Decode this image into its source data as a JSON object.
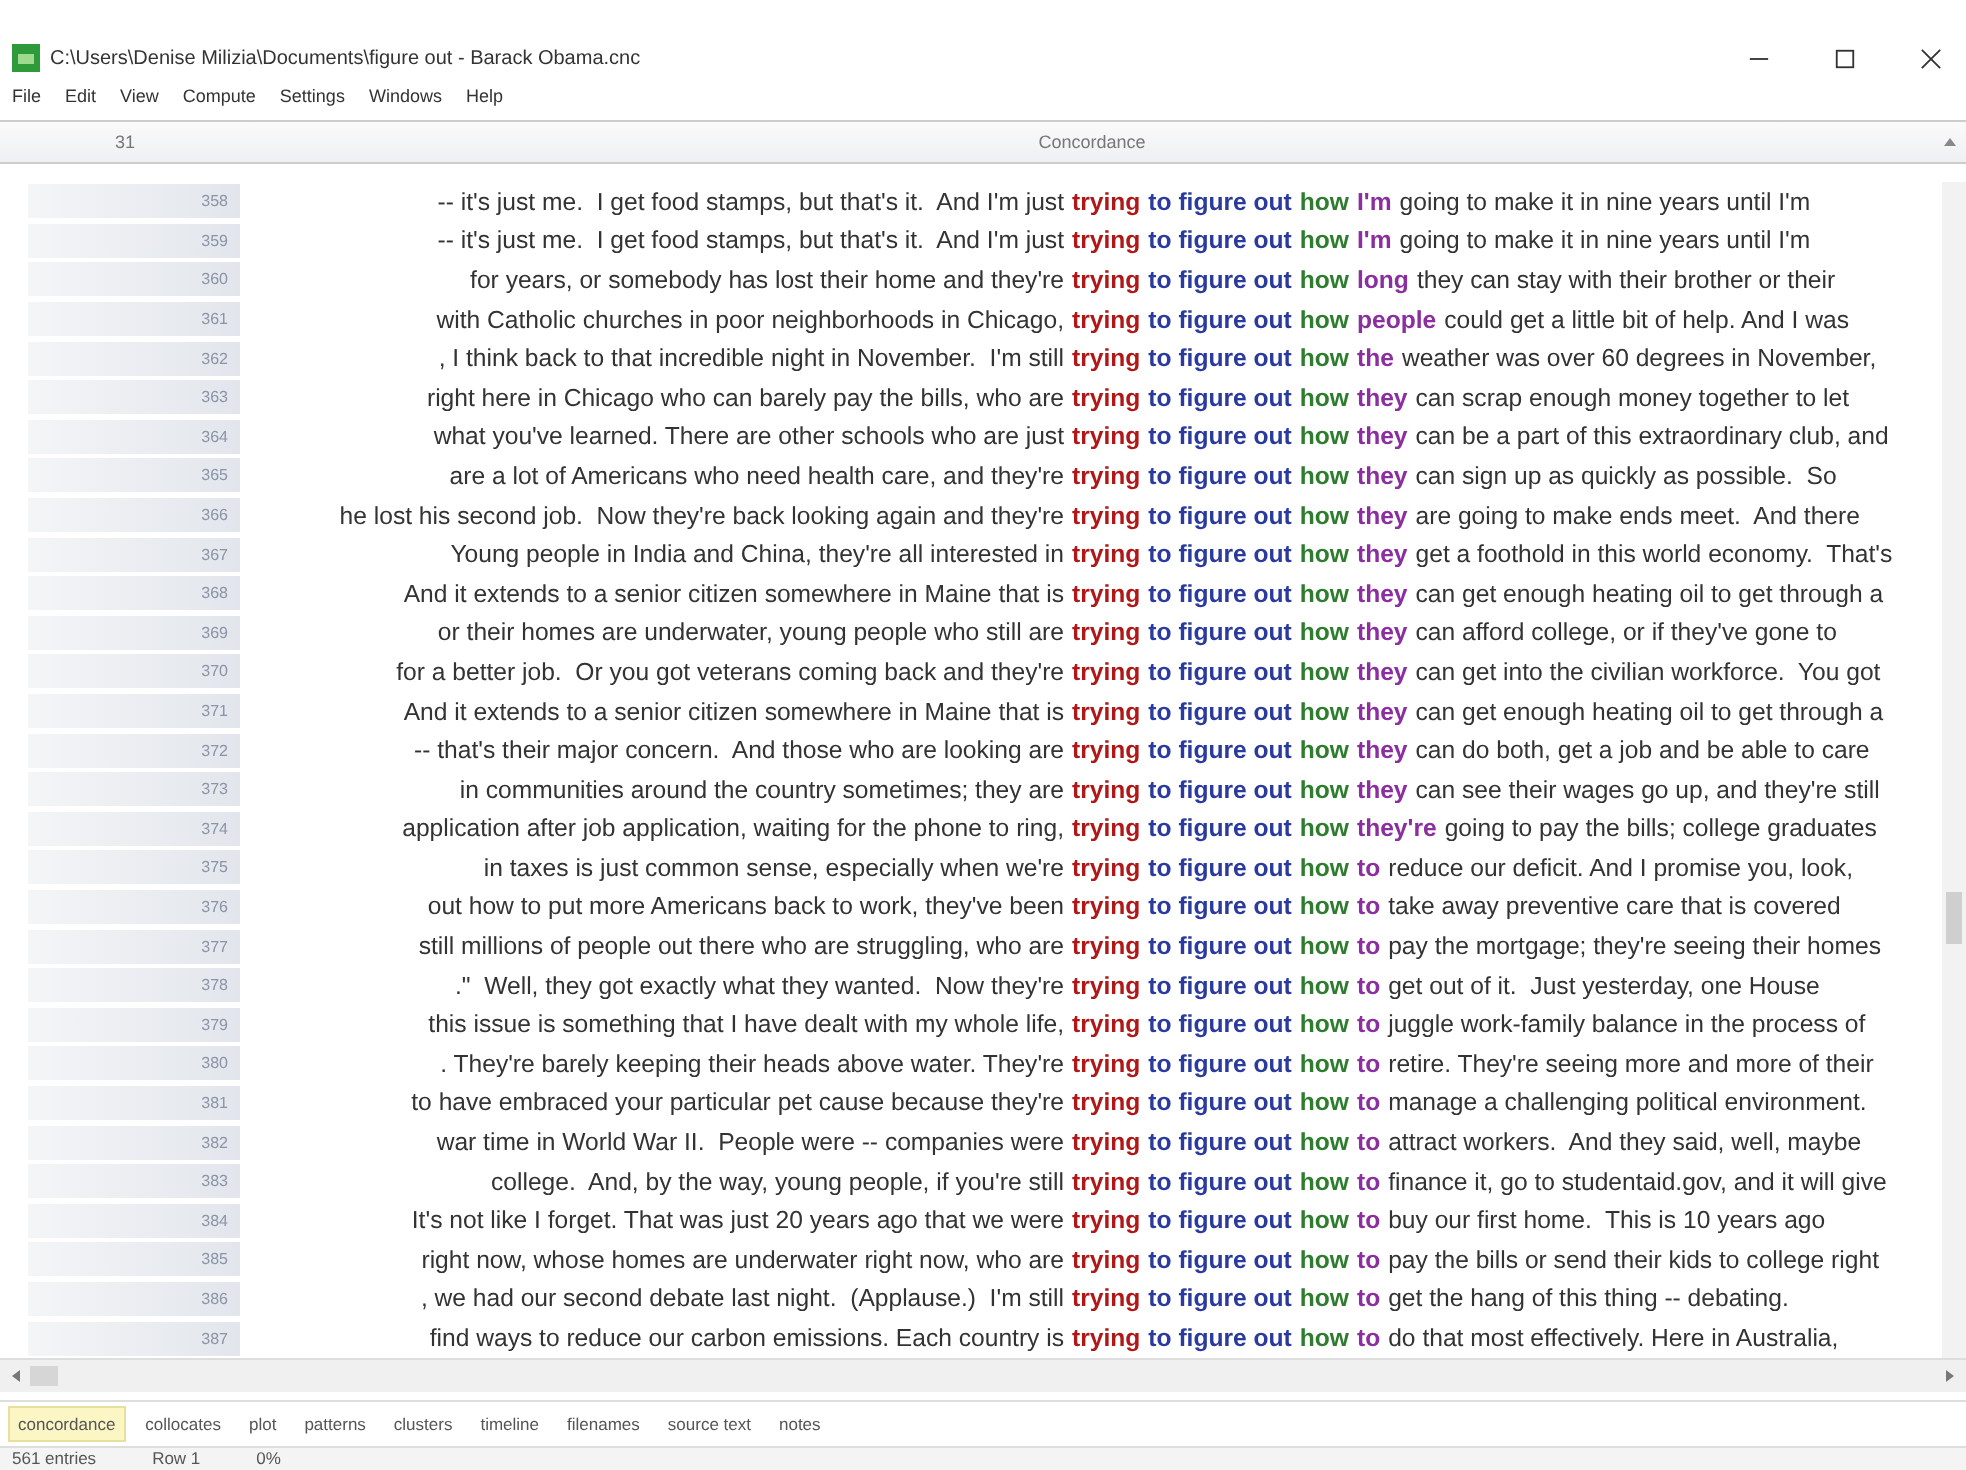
{
  "window": {
    "title": "C:\\Users\\Denise Milizia\\Documents\\figure out - Barack Obama.cnc"
  },
  "menu": [
    "File",
    "Edit",
    "View",
    "Compute",
    "Settings",
    "Windows",
    "Help"
  ],
  "table": {
    "count": "31",
    "title": "Concordance",
    "rows": [
      {
        "n": "358",
        "left": "-- it's just me.  I get food stamps, but that's it.  And I'm just",
        "w": [
          "trying",
          "to figure out",
          "how",
          "I'm"
        ],
        "right": "going to make it in nine years until I'm"
      },
      {
        "n": "359",
        "left": "-- it's just me.  I get food stamps, but that's it.  And I'm just",
        "w": [
          "trying",
          "to figure out",
          "how",
          "I'm"
        ],
        "right": "going to make it in nine years until I'm"
      },
      {
        "n": "360",
        "left": "for years, or somebody has lost their home and they're",
        "w": [
          "trying",
          "to figure out",
          "how",
          "long"
        ],
        "right": "they can stay with their brother or their"
      },
      {
        "n": "361",
        "left": "with Catholic churches in poor neighborhoods in Chicago,",
        "w": [
          "trying",
          "to figure out",
          "how",
          "people"
        ],
        "right": "could get a little bit of help. And I was"
      },
      {
        "n": "362",
        "left": ", I think back to that incredible night in November.  I'm still",
        "w": [
          "trying",
          "to figure out",
          "how",
          "the"
        ],
        "right": "weather was over 60 degrees in November,"
      },
      {
        "n": "363",
        "left": "right here in Chicago who can barely pay the bills, who are",
        "w": [
          "trying",
          "to figure out",
          "how",
          "they"
        ],
        "right": "can scrap enough money together to let"
      },
      {
        "n": "364",
        "left": "what you've learned. There are other schools who are just",
        "w": [
          "trying",
          "to figure out",
          "how",
          "they"
        ],
        "right": "can be a part of this extraordinary club, and"
      },
      {
        "n": "365",
        "left": "are a lot of Americans who need health care, and they're",
        "w": [
          "trying",
          "to figure out",
          "how",
          "they"
        ],
        "right": "can sign up as quickly as possible.  So"
      },
      {
        "n": "366",
        "left": "he lost his second job.  Now they're back looking again and they're",
        "w": [
          "trying",
          "to figure out",
          "how",
          "they"
        ],
        "right": "are going to make ends meet.  And there"
      },
      {
        "n": "367",
        "left": "Young people in India and China, they're all interested in",
        "w": [
          "trying",
          "to figure out",
          "how",
          "they"
        ],
        "right": "get a foothold in this world economy.  That's"
      },
      {
        "n": "368",
        "left": "And it extends to a senior citizen somewhere in Maine that is",
        "w": [
          "trying",
          "to figure out",
          "how",
          "they"
        ],
        "right": "can get enough heating oil to get through a"
      },
      {
        "n": "369",
        "left": "or their homes are underwater, young people who still are",
        "w": [
          "trying",
          "to figure out",
          "how",
          "they"
        ],
        "right": "can afford college, or if they've gone to"
      },
      {
        "n": "370",
        "left": "for a better job.  Or you got veterans coming back and they're",
        "w": [
          "trying",
          "to figure out",
          "how",
          "they"
        ],
        "right": "can get into the civilian workforce.  You got"
      },
      {
        "n": "371",
        "left": "And it extends to a senior citizen somewhere in Maine that is",
        "w": [
          "trying",
          "to figure out",
          "how",
          "they"
        ],
        "right": "can get enough heating oil to get through a"
      },
      {
        "n": "372",
        "left": "-- that's their major concern.  And those who are looking are",
        "w": [
          "trying",
          "to figure out",
          "how",
          "they"
        ],
        "right": "can do both, get a job and be able to care"
      },
      {
        "n": "373",
        "left": "in communities around the country sometimes; they are",
        "w": [
          "trying",
          "to figure out",
          "how",
          "they"
        ],
        "right": "can see their wages go up, and they're still"
      },
      {
        "n": "374",
        "left": "application after job application, waiting for the phone to ring,",
        "w": [
          "trying",
          "to figure out",
          "how",
          "they're"
        ],
        "right": "going to pay the bills; college graduates"
      },
      {
        "n": "375",
        "left": "in taxes is just common sense, especially when we're",
        "w": [
          "trying",
          "to figure out",
          "how",
          "to"
        ],
        "right": "reduce our deficit. And I promise you, look,"
      },
      {
        "n": "376",
        "left": "out how to put more Americans back to work, they've been",
        "w": [
          "trying",
          "to figure out",
          "how",
          "to"
        ],
        "right": "take away preventive care that is covered"
      },
      {
        "n": "377",
        "left": "still millions of people out there who are struggling, who are",
        "w": [
          "trying",
          "to figure out",
          "how",
          "to"
        ],
        "right": "pay the mortgage; they're seeing their homes"
      },
      {
        "n": "378",
        "left": ".\"  Well, they got exactly what they wanted.  Now they're",
        "w": [
          "trying",
          "to figure out",
          "how",
          "to"
        ],
        "right": "get out of it.  Just yesterday, one House"
      },
      {
        "n": "379",
        "left": "this issue is something that I have dealt with my whole life,",
        "w": [
          "trying",
          "to figure out",
          "how",
          "to"
        ],
        "right": "juggle work-family balance in the process of"
      },
      {
        "n": "380",
        "left": ". They're barely keeping their heads above water. They're",
        "w": [
          "trying",
          "to figure out",
          "how",
          "to"
        ],
        "right": "retire. They're seeing more and more of their"
      },
      {
        "n": "381",
        "left": "to have embraced your particular pet cause because they're",
        "w": [
          "trying",
          "to figure out",
          "how",
          "to"
        ],
        "right": "manage a challenging political environment."
      },
      {
        "n": "382",
        "left": "war time in World War II.  People were -- companies were",
        "w": [
          "trying",
          "to figure out",
          "how",
          "to"
        ],
        "right": "attract workers.  And they said, well, maybe"
      },
      {
        "n": "383",
        "left": "college.  And, by the way, young people, if you're still",
        "w": [
          "trying",
          "to figure out",
          "how",
          "to"
        ],
        "right": "finance it, go to studentaid.gov, and it will give"
      },
      {
        "n": "384",
        "left": "It's not like I forget. That was just 20 years ago that we were",
        "w": [
          "trying",
          "to figure out",
          "how",
          "to"
        ],
        "right": "buy our first home.  This is 10 years ago"
      },
      {
        "n": "385",
        "left": "right now, whose homes are underwater right now, who are",
        "w": [
          "trying",
          "to figure out",
          "how",
          "to"
        ],
        "right": "pay the bills or send their kids to college right"
      },
      {
        "n": "386",
        "left": ", we had our second debate last night.  (Applause.)  I'm still",
        "w": [
          "trying",
          "to figure out",
          "how",
          "to"
        ],
        "right": "get the hang of this thing -- debating."
      },
      {
        "n": "387",
        "left": "find ways to reduce our carbon emissions. Each country is",
        "w": [
          "trying",
          "to figure out",
          "how",
          "to"
        ],
        "right": "do that most effectively. Here in Australia,"
      }
    ]
  },
  "tabs": [
    {
      "label": "concordance",
      "selected": true
    },
    {
      "label": "collocates",
      "selected": false
    },
    {
      "label": "plot",
      "selected": false
    },
    {
      "label": "patterns",
      "selected": false
    },
    {
      "label": "clusters",
      "selected": false
    },
    {
      "label": "timeline",
      "selected": false
    },
    {
      "label": "filenames",
      "selected": false
    },
    {
      "label": "source text",
      "selected": false
    },
    {
      "label": "notes",
      "selected": false
    }
  ],
  "status_bar": [
    "561 entries",
    "Row 1",
    "0%"
  ]
}
